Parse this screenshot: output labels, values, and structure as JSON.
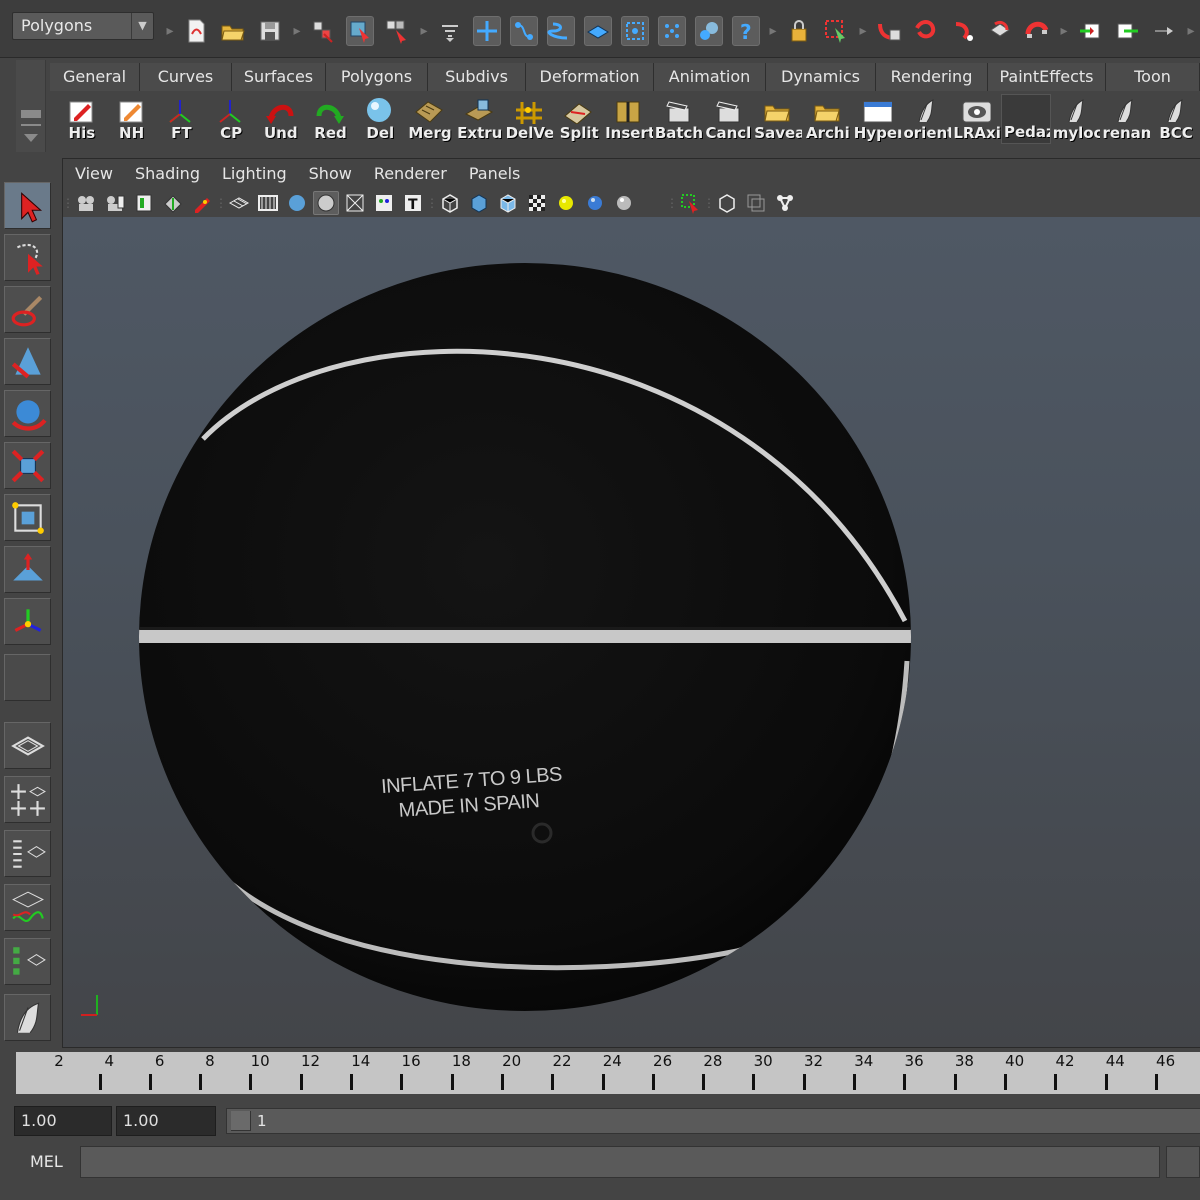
{
  "statusline": {
    "menuset": "Polygons",
    "icons": [
      "new-scene-icon",
      "open-scene-icon",
      "save-scene-icon",
      "select-hierarchy-icon",
      "select-object-icon",
      "select-component-icon",
      "selection-mask-icon",
      "snap-grid-icon",
      "snap-curve-icon",
      "snap-point-icon",
      "snap-plane-icon",
      "snap-live-icon",
      "history-icon",
      "construction-history-icon",
      "help-icon",
      "lock-icon",
      "select-lock-icon",
      "input-connections-icon",
      "output-connections-icon",
      "construction-on-icon",
      "render-icon",
      "ipr-render-icon",
      "render-settings-icon",
      "input-ops-icon",
      "output-ops-icon",
      "channel-box-icon"
    ]
  },
  "shelf": {
    "tabs": [
      "General",
      "Curves",
      "Surfaces",
      "Polygons",
      "Subdivs",
      "Deformation",
      "Animation",
      "Dynamics",
      "Rendering",
      "PaintEffects",
      "Toon"
    ],
    "buttons": [
      {
        "label": "His",
        "icon": "history-pencil-icon"
      },
      {
        "label": "NH",
        "icon": "no-history-pencil-icon"
      },
      {
        "label": "FT",
        "icon": "freeze-transform-icon"
      },
      {
        "label": "CP",
        "icon": "center-pivot-icon"
      },
      {
        "label": "Und",
        "icon": "undo-icon"
      },
      {
        "label": "Red",
        "icon": "redo-icon"
      },
      {
        "label": "Del",
        "icon": "delete-icon"
      },
      {
        "label": "Merg",
        "icon": "merge-icon"
      },
      {
        "label": "Extru",
        "icon": "extrude-icon"
      },
      {
        "label": "DelVe",
        "icon": "delete-vertex-icon"
      },
      {
        "label": "Split",
        "icon": "split-polygon-icon"
      },
      {
        "label": "Insert",
        "icon": "insert-edge-loop-icon"
      },
      {
        "label": "Batch",
        "icon": "batch-clapper-icon"
      },
      {
        "label": "Cancl",
        "icon": "cancel-clapper-icon"
      },
      {
        "label": "Savea",
        "icon": "save-folder-icon"
      },
      {
        "label": "Archi",
        "icon": "archive-folder-icon"
      },
      {
        "label": "Hyper",
        "icon": "hypershade-window-icon"
      },
      {
        "label": "orient",
        "icon": "orient-script-icon"
      },
      {
        "label": "LRAxi",
        "icon": "local-rotation-axis-icon"
      },
      {
        "label": "Pedaz",
        "icon": "empty-slot-icon"
      },
      {
        "label": "myloc",
        "icon": "script-feather-icon"
      },
      {
        "label": "renam",
        "icon": "rename-script-icon"
      },
      {
        "label": "BCC",
        "icon": "bcc-script-icon"
      }
    ]
  },
  "toolbox": {
    "tools": [
      "select-tool-icon",
      "lasso-tool-icon",
      "paint-select-tool-icon",
      "move-tool-icon",
      "rotate-tool-icon",
      "scale-tool-icon",
      "universal-manipulator-icon",
      "soft-modification-icon",
      "show-manipulator-icon",
      "last-tool-slot",
      "single-perspective-layout-icon",
      "four-view-layout-icon",
      "outliner-persp-layout-icon",
      "graph-editor-persp-layout-icon",
      "hypershade-persp-layout-icon",
      "feather-script-icon"
    ]
  },
  "panel": {
    "menus": [
      "View",
      "Shading",
      "Lighting",
      "Show",
      "Renderer",
      "Panels"
    ],
    "tools": [
      "camera-attributes-icon",
      "bookmark-camera-icon",
      "image-plane-icon",
      "two-d-pan-zoom-icon",
      "grease-pencil-icon",
      "grid-icon",
      "film-gate-icon",
      "resolution-gate-icon",
      "gate-mask-icon",
      "field-chart-icon",
      "safe-action-icon",
      "safe-title-icon",
      "wireframe-icon",
      "smooth-shade-icon",
      "wireframe-on-shaded-icon",
      "xray-icon",
      "use-default-material-icon",
      "all-lights-icon",
      "default-lighting-icon",
      "flat-lighting-icon",
      "isolate-select-icon",
      "xray-joints-icon",
      "xray-active-icon",
      "high-quality-icon"
    ]
  },
  "viewport": {
    "ball_text_line1": "INFLATE 7 TO 9 LBS",
    "ball_text_line2": "MADE IN SPAIN",
    "colors": {
      "ball": "#0c0c0c",
      "seam": "#c8c8c8",
      "bg_top": "#4f5864",
      "bg_bottom": "#434549",
      "axis_x": "#d02020",
      "axis_y": "#20b020"
    }
  },
  "timeslider": {
    "labels": [
      "2",
      "4",
      "6",
      "8",
      "10",
      "12",
      "14",
      "16",
      "18",
      "20",
      "22",
      "24",
      "26",
      "28",
      "30",
      "32",
      "34",
      "36",
      "38",
      "40",
      "42",
      "44",
      "46"
    ]
  },
  "range": {
    "start": "1.00",
    "playback_start": "1.00",
    "current": "1"
  },
  "command": {
    "label": "MEL"
  }
}
